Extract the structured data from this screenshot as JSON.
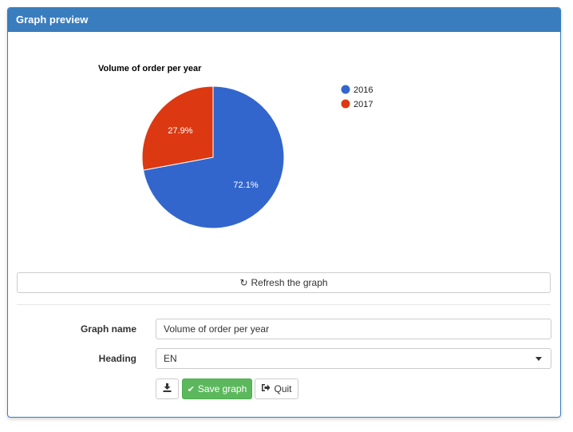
{
  "panel": {
    "title": "Graph preview"
  },
  "chart_data": {
    "type": "pie",
    "title": "Volume of order per year",
    "categories": [
      "2016",
      "2017"
    ],
    "values": [
      72.1,
      27.9
    ],
    "labels": [
      "72.1%",
      "27.9%"
    ],
    "colors": [
      "#3366cc",
      "#dc3912"
    ],
    "legend": "right"
  },
  "refresh": {
    "label": "Refresh the graph",
    "icon": "refresh-icon"
  },
  "form": {
    "graph_name_label": "Graph name",
    "graph_name_value": "Volume of order per year",
    "heading_label": "Heading",
    "heading_value": "EN"
  },
  "actions": {
    "download_icon": "download-icon",
    "save_label": "Save graph",
    "save_icon": "check-icon",
    "quit_label": "Quit",
    "quit_icon": "sign-out-icon"
  }
}
